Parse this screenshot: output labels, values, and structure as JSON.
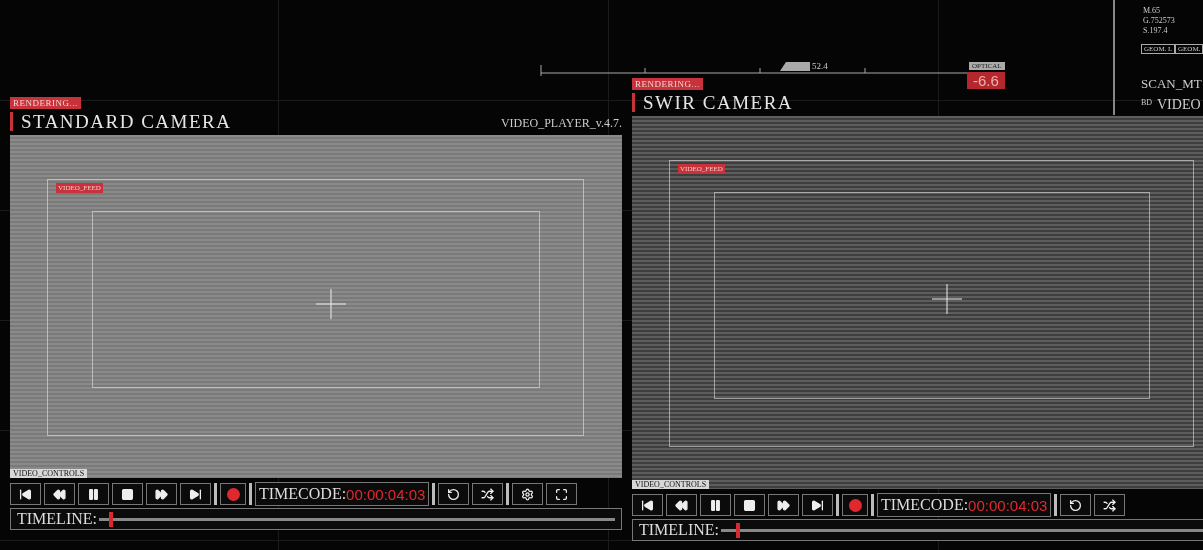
{
  "hud": {
    "scale_value": "52.4",
    "optical_label": "OPTICAL",
    "optical_value": "-6.6",
    "readouts": [
      "M.65",
      "G.752573",
      "S.197.4"
    ],
    "tags": [
      "GEOM. L",
      "GEOM."
    ],
    "scan_label": "SCAN_MT",
    "video_prefix": "BD",
    "video_label": "VIDEO"
  },
  "panels": [
    {
      "kind": "thermal",
      "status": "RENDERING...",
      "title": "STANDARD CAMERA",
      "version": "VIDEO_PLAYER_v.4.7.",
      "feed_label": "VIDEO_FEED",
      "controls_label": "VIDEO_CONTROLS",
      "transport": [
        {
          "kind": "skip-back"
        },
        {
          "kind": "rewind"
        },
        {
          "kind": "pause"
        },
        {
          "kind": "stop"
        },
        {
          "kind": "forward"
        },
        {
          "kind": "skip-forward"
        }
      ],
      "recording": true,
      "timecode_label": "TIMECODE:",
      "timecode": "00:00:04:03",
      "tools": [
        {
          "kind": "replay"
        },
        {
          "kind": "shuffle"
        },
        {
          "kind": "settings"
        },
        {
          "kind": "fullscreen"
        }
      ],
      "timeline_label": "TIMELINE:",
      "timeline": {
        "level": 0.02
      }
    },
    {
      "kind": "swir",
      "status": "RENDERING...",
      "title": "SWIR CAMERA",
      "feed_label": "VIDEO_FEED",
      "controls_label": "VIDEO_CONTROLS",
      "transport": [
        {
          "kind": "skip-back"
        },
        {
          "kind": "rewind"
        },
        {
          "kind": "pause"
        },
        {
          "kind": "stop"
        },
        {
          "kind": "forward"
        },
        {
          "kind": "skip-forward"
        }
      ],
      "recording": true,
      "timecode_label": "TIMECODE:",
      "timecode": "00:00:04:03",
      "tools": [
        {
          "kind": "replay"
        },
        {
          "kind": "shuffle"
        }
      ],
      "timeline_label": "TIMELINE:",
      "timeline": {
        "level": 0.03
      }
    }
  ]
}
